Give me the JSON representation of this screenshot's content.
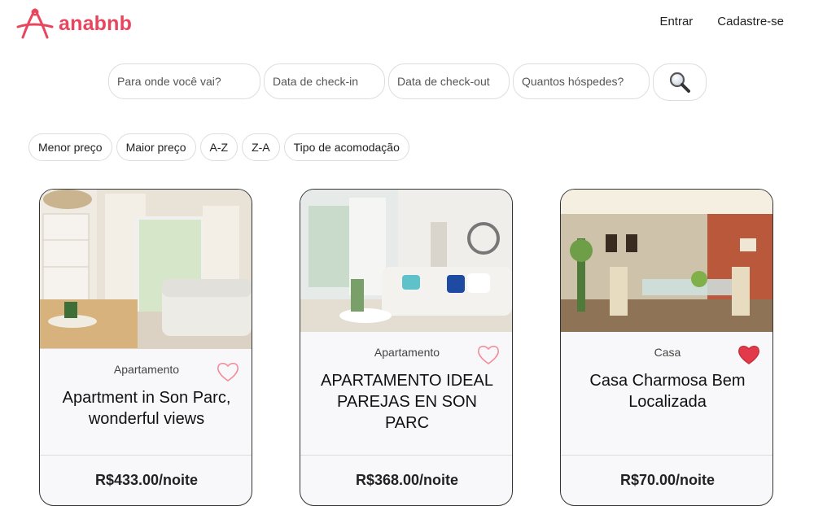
{
  "app": {
    "brand": "anabnb",
    "brand_color": "#e8455f"
  },
  "nav": {
    "login": "Entrar",
    "signup": "Cadastre-se"
  },
  "search": {
    "destination_placeholder": "Para onde você vai?",
    "checkin_placeholder": "Data de check-in",
    "checkout_placeholder": "Data de check-out",
    "guests_placeholder": "Quantos hóspedes?",
    "button_icon": "magnifier-icon"
  },
  "filters": [
    "Menor preço",
    "Maior preço",
    "A-Z",
    "Z-A",
    "Tipo de acomodação"
  ],
  "listings": [
    {
      "type": "Apartamento",
      "title": "Apartment in Son Parc, wonderful views",
      "price": "R$433.00/noite",
      "favorite": false
    },
    {
      "type": "Apartamento",
      "title": "APARTAMENTO IDEAL PAREJAS EN SON PARC",
      "price": "R$368.00/noite",
      "favorite": false
    },
    {
      "type": "Casa",
      "title": "Casa Charmosa Bem Localizada",
      "price": "R$70.00/noite",
      "favorite": true
    }
  ]
}
